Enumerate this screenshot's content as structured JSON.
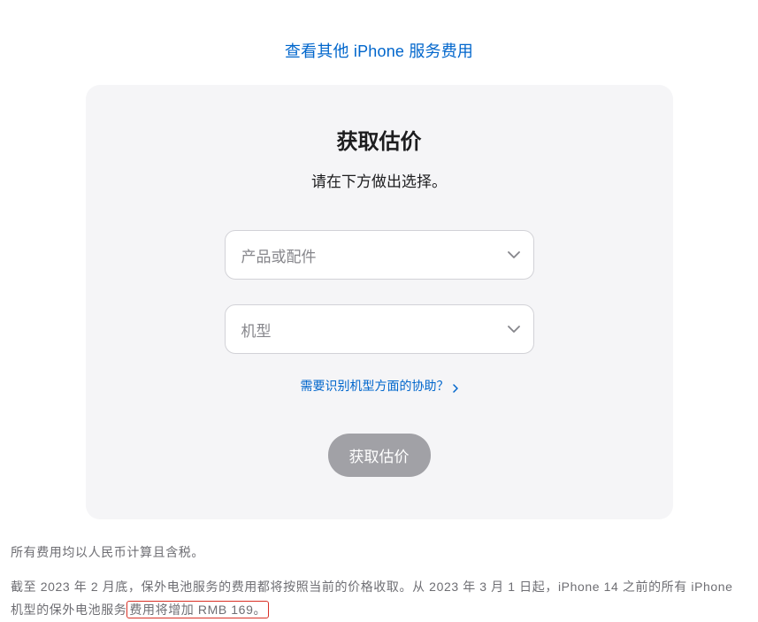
{
  "top_link": {
    "label": "查看其他 iPhone 服务费用"
  },
  "card": {
    "title": "获取估价",
    "subtitle": "请在下方做出选择。",
    "select_product": {
      "placeholder": "产品或配件"
    },
    "select_model": {
      "placeholder": "机型"
    },
    "help_link": {
      "label": "需要识别机型方面的协助？"
    },
    "submit_button": {
      "label": "获取估价"
    }
  },
  "footer": {
    "line1": "所有费用均以人民币计算且含税。",
    "line2_part1": "截至 2023 年 2 月底，保外电池服务的费用都将按照当前的价格收取。从 2023 年 3 月 1 日起，iPhone 14 之前的所有 iPhone 机型的保外电池服务",
    "line2_highlight": "费用将增加 RMB 169。"
  }
}
